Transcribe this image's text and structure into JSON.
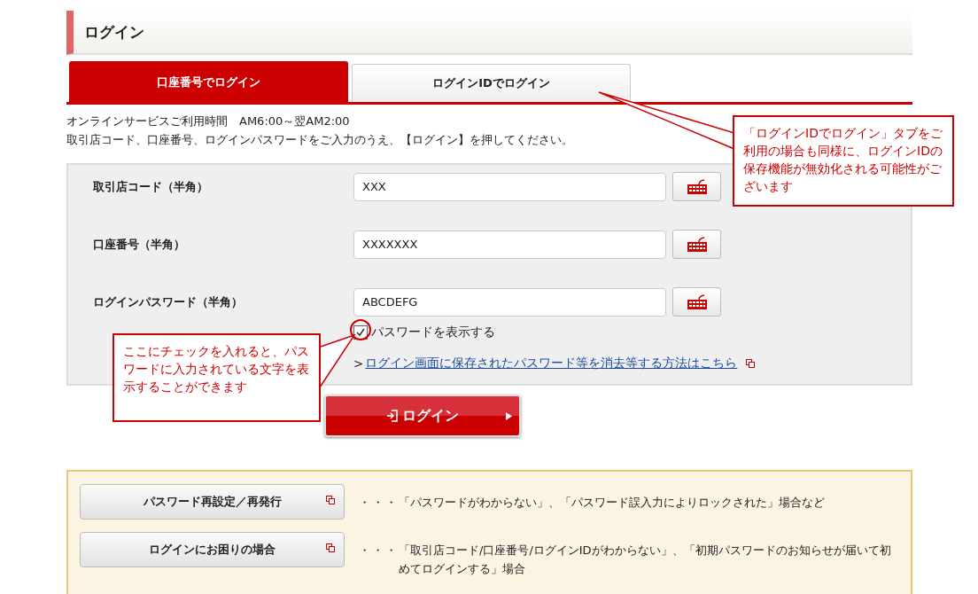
{
  "page_title": "ログイン",
  "tabs": [
    {
      "label": "口座番号でログイン",
      "selected": true
    },
    {
      "label": "ログインIDでログイン",
      "selected": false
    }
  ],
  "notice": [
    "オンラインサービスご利用時間　AM6:00～翌AM2:00",
    "取引店コード、口座番号、ログインパスワードをご入力のうえ、【ログイン】を押してください。"
  ],
  "fields": [
    {
      "label": "取引店コード（半角）",
      "value": "XXX"
    },
    {
      "label": "口座番号（半角）",
      "value": "XXXXXXX"
    },
    {
      "label": "ログインパスワード（半角）",
      "value": "ABCDEFG"
    }
  ],
  "show_password": {
    "label": "パスワードを表示する",
    "checked": true
  },
  "help_link": {
    "prefix": ">",
    "text": "ログイン画面に保存されたパスワード等を消去等する方法はこちら"
  },
  "login_button": "ログイン",
  "help": [
    {
      "button": "パスワード再設定／再発行",
      "dots": "・・・",
      "description": "「パスワードがわからない」、「パスワード誤入力によりロックされた」場合など"
    },
    {
      "button": "ログインにお困りの場合",
      "dots": "・・・",
      "description": "「取引店コード/口座番号/ログインIDがわからない」、「初期パスワードのお知らせが届いて初めてログインする」場合"
    }
  ],
  "annotations": [
    {
      "text": "「ログインIDでログイン」タブをご利用の場合も同様に、ログインIDの保存機能が無効化される可能性がございます"
    },
    {
      "text": "ここにチェックを入れると、パスワードに入力されている文字を表示することができます"
    }
  ]
}
